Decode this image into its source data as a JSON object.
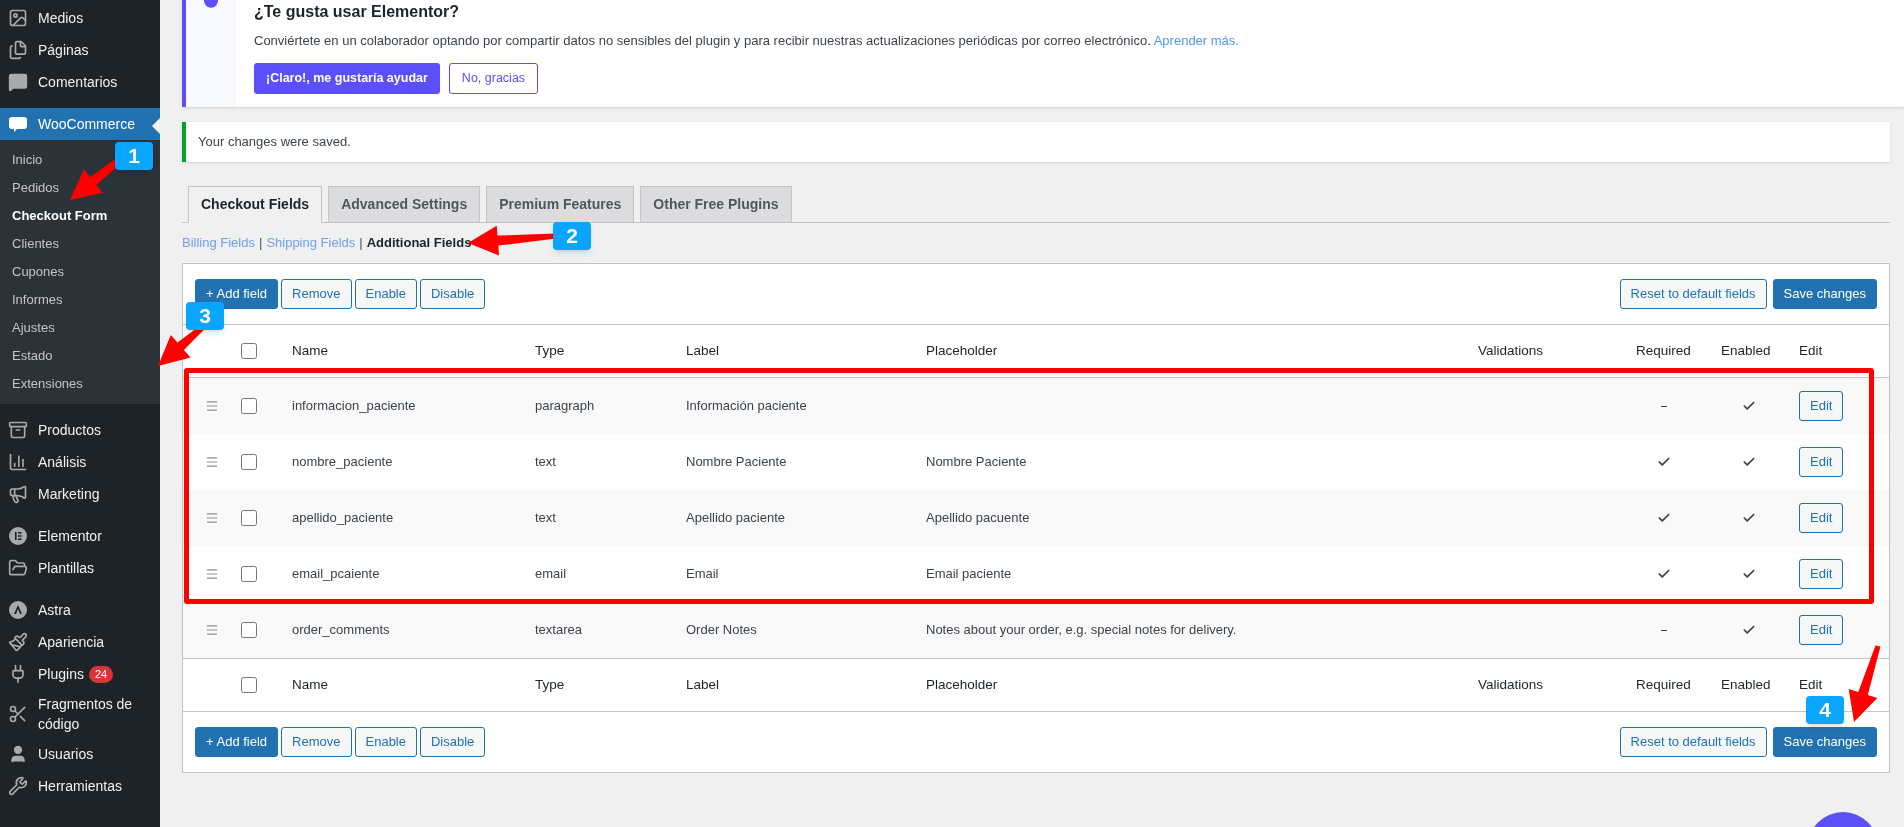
{
  "sidebar": {
    "items": [
      {
        "label": "Medios",
        "selected": false
      },
      {
        "label": "Páginas",
        "selected": false
      },
      {
        "label": "Comentarios",
        "selected": false
      },
      {
        "label": "WooCommerce",
        "selected": true,
        "expanded": true,
        "children": [
          {
            "label": "Inicio",
            "selected": false
          },
          {
            "label": "Pedidos",
            "selected": false
          },
          {
            "label": "Checkout Form",
            "selected": true
          },
          {
            "label": "Clientes",
            "selected": false
          },
          {
            "label": "Cupones",
            "selected": false
          },
          {
            "label": "Informes",
            "selected": false
          },
          {
            "label": "Ajustes",
            "selected": false
          },
          {
            "label": "Estado",
            "selected": false
          },
          {
            "label": "Extensiones",
            "selected": false
          }
        ]
      },
      {
        "label": "Productos",
        "selected": false
      },
      {
        "label": "Análisis",
        "selected": false
      },
      {
        "label": "Marketing",
        "selected": false
      },
      {
        "label": "Elementor",
        "selected": false
      },
      {
        "label": "Plantillas",
        "selected": false
      },
      {
        "label": "Astra",
        "selected": false
      },
      {
        "label": "Apariencia",
        "selected": false
      },
      {
        "label": "Plugins",
        "selected": false,
        "badge": "24"
      },
      {
        "label": "Fragmentos de código",
        "selected": false
      },
      {
        "label": "Usuarios",
        "selected": false
      },
      {
        "label": "Herramientas",
        "selected": false
      }
    ]
  },
  "elementor_notice": {
    "title": "¿Te gusta usar Elementor?",
    "text": "Conviértete en un colaborador optando por compartir datos no sensibles del plugin y para recibir nuestras actualizaciones periódicas por correo electrónico.",
    "link": "Aprender más.",
    "buttons": [
      "¡Claro!, me gustaría ayudar",
      "No, gracias"
    ]
  },
  "saved_notice": "Your changes were saved.",
  "tabs": [
    {
      "label": "Checkout Fields",
      "selected": true
    },
    {
      "label": "Advanced Settings",
      "selected": false
    },
    {
      "label": "Premium Features",
      "selected": false
    },
    {
      "label": "Other Free Plugins",
      "selected": false
    }
  ],
  "sections": [
    {
      "label": "Billing Fields",
      "selected": false
    },
    {
      "label": "Shipping Fields",
      "selected": false
    },
    {
      "label": "Additional Fields",
      "selected": true
    }
  ],
  "separator": "|",
  "toolbar": {
    "left": [
      "+ Add field",
      "Remove",
      "Enable",
      "Disable"
    ],
    "right": [
      "Reset to default fields",
      "Save changes"
    ]
  },
  "table": {
    "columns": [
      "Name",
      "Type",
      "Label",
      "Placeholder",
      "Validations",
      "Required",
      "Enabled",
      "Edit"
    ],
    "rows": [
      {
        "name": "informacion_paciente",
        "type": "paragraph",
        "label": "Información paciente",
        "placeholder": "",
        "checked": false,
        "required": false,
        "enabled": true,
        "edit": "Edit"
      },
      {
        "name": "nombre_paciente",
        "type": "text",
        "label": "Nombre Paciente",
        "placeholder": "Nombre Paciente",
        "checked": false,
        "required": true,
        "enabled": true,
        "edit": "Edit"
      },
      {
        "name": "apellido_paciente",
        "type": "text",
        "label": "Apellido paciente",
        "placeholder": "Apellido pacuente",
        "checked": false,
        "required": true,
        "enabled": true,
        "edit": "Edit"
      },
      {
        "name": "email_pcaiente",
        "type": "email",
        "label": "Email",
        "placeholder": "Email paciente",
        "checked": false,
        "required": true,
        "enabled": true,
        "edit": "Edit"
      },
      {
        "name": "order_comments",
        "type": "textarea",
        "label": "Order Notes",
        "placeholder": "Notes about your order, e.g. special notes for delivery.",
        "checked": false,
        "required": false,
        "enabled": true,
        "edit": "Edit"
      }
    ],
    "footer_columns": [
      "Name",
      "Type",
      "Label",
      "Placeholder",
      "Validations",
      "Required",
      "Enabled",
      "Edit"
    ],
    "select_all_checked": false,
    "footer_select_all_checked": false
  },
  "bottom_toolbar": {
    "left": [
      "+ Add field",
      "Remove",
      "Enable",
      "Disable"
    ],
    "right": [
      "Reset to default fields",
      "Save changes"
    ]
  },
  "annotations": [
    {
      "label": "1"
    },
    {
      "label": "2"
    },
    {
      "label": "3"
    },
    {
      "label": "4"
    }
  ]
}
